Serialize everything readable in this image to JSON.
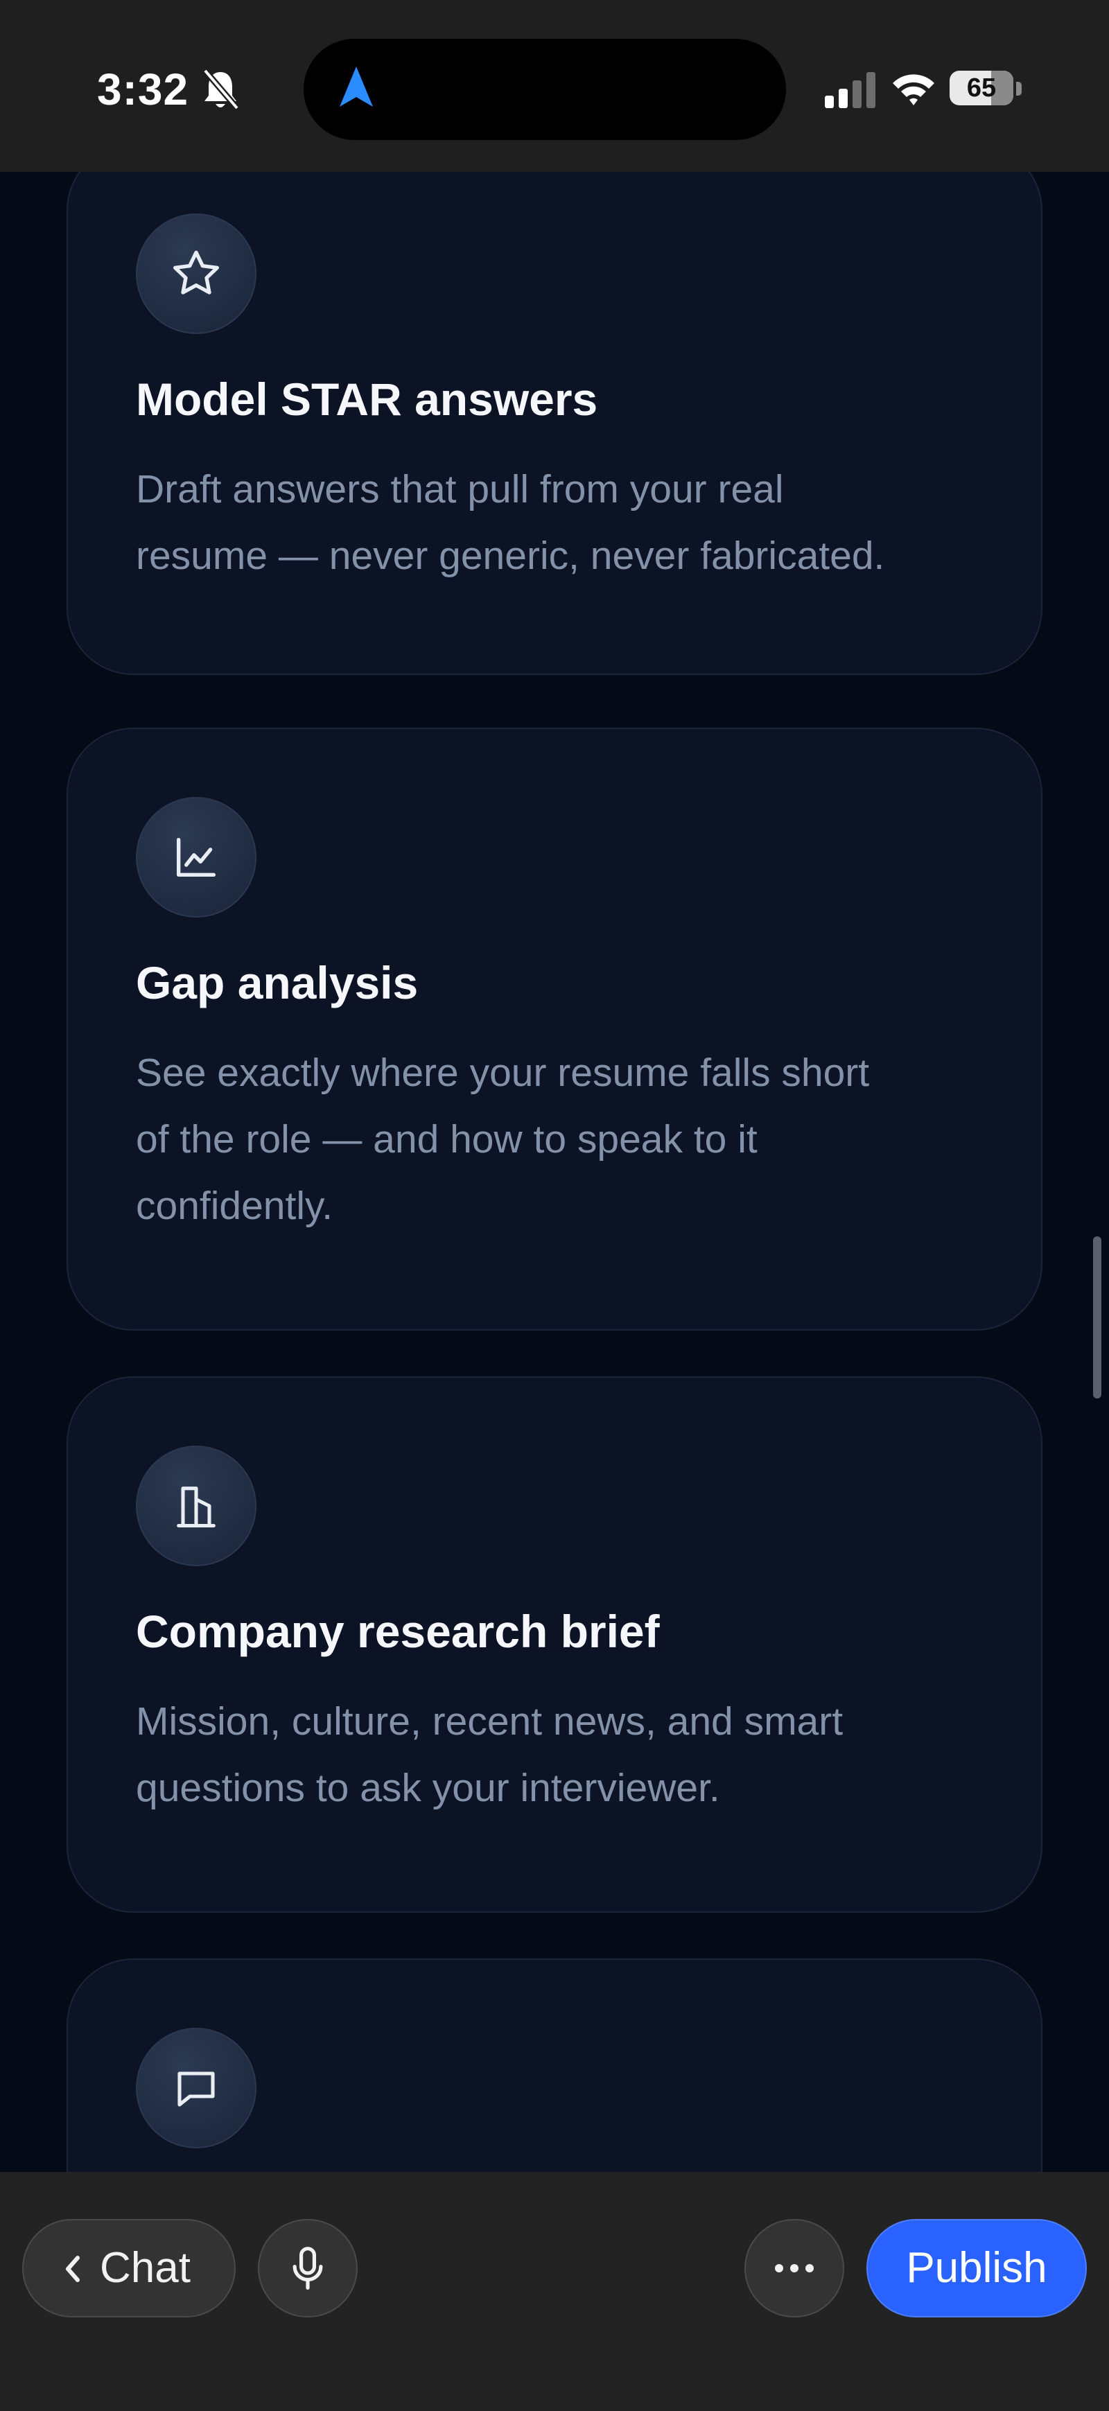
{
  "status_bar": {
    "time": "3:32",
    "battery": "65",
    "icons": [
      "bell-slash-icon",
      "location-arrow-icon",
      "cellular-signal-icon",
      "wifi-icon",
      "battery-icon"
    ]
  },
  "features": [
    {
      "icon": "star-icon",
      "title": "Model STAR answers",
      "desc_lines": [
        "Draft answers that pull from your real",
        "resume — never generic, never fabricated."
      ]
    },
    {
      "icon": "line-chart-icon",
      "title": "Gap analysis",
      "desc_lines": [
        "See exactly where your resume falls short",
        "of the role — and how to speak to it",
        "confidently."
      ]
    },
    {
      "icon": "building-icon",
      "title": "Company research brief",
      "desc_lines": [
        "Mission, culture, recent news, and smart",
        "questions to ask your interviewer."
      ]
    },
    {
      "icon": "message-square-icon",
      "title": "",
      "desc_lines": []
    }
  ],
  "bottom_bar": {
    "chat_label": "Chat",
    "publish_label": "Publish",
    "icons": [
      "chevron-left-icon",
      "microphone-icon",
      "more-horizontal-icon"
    ]
  },
  "colors": {
    "background": "#050a17",
    "card": "#0b1324",
    "accent": "#2962ff",
    "muted_text": "#8492a9"
  }
}
